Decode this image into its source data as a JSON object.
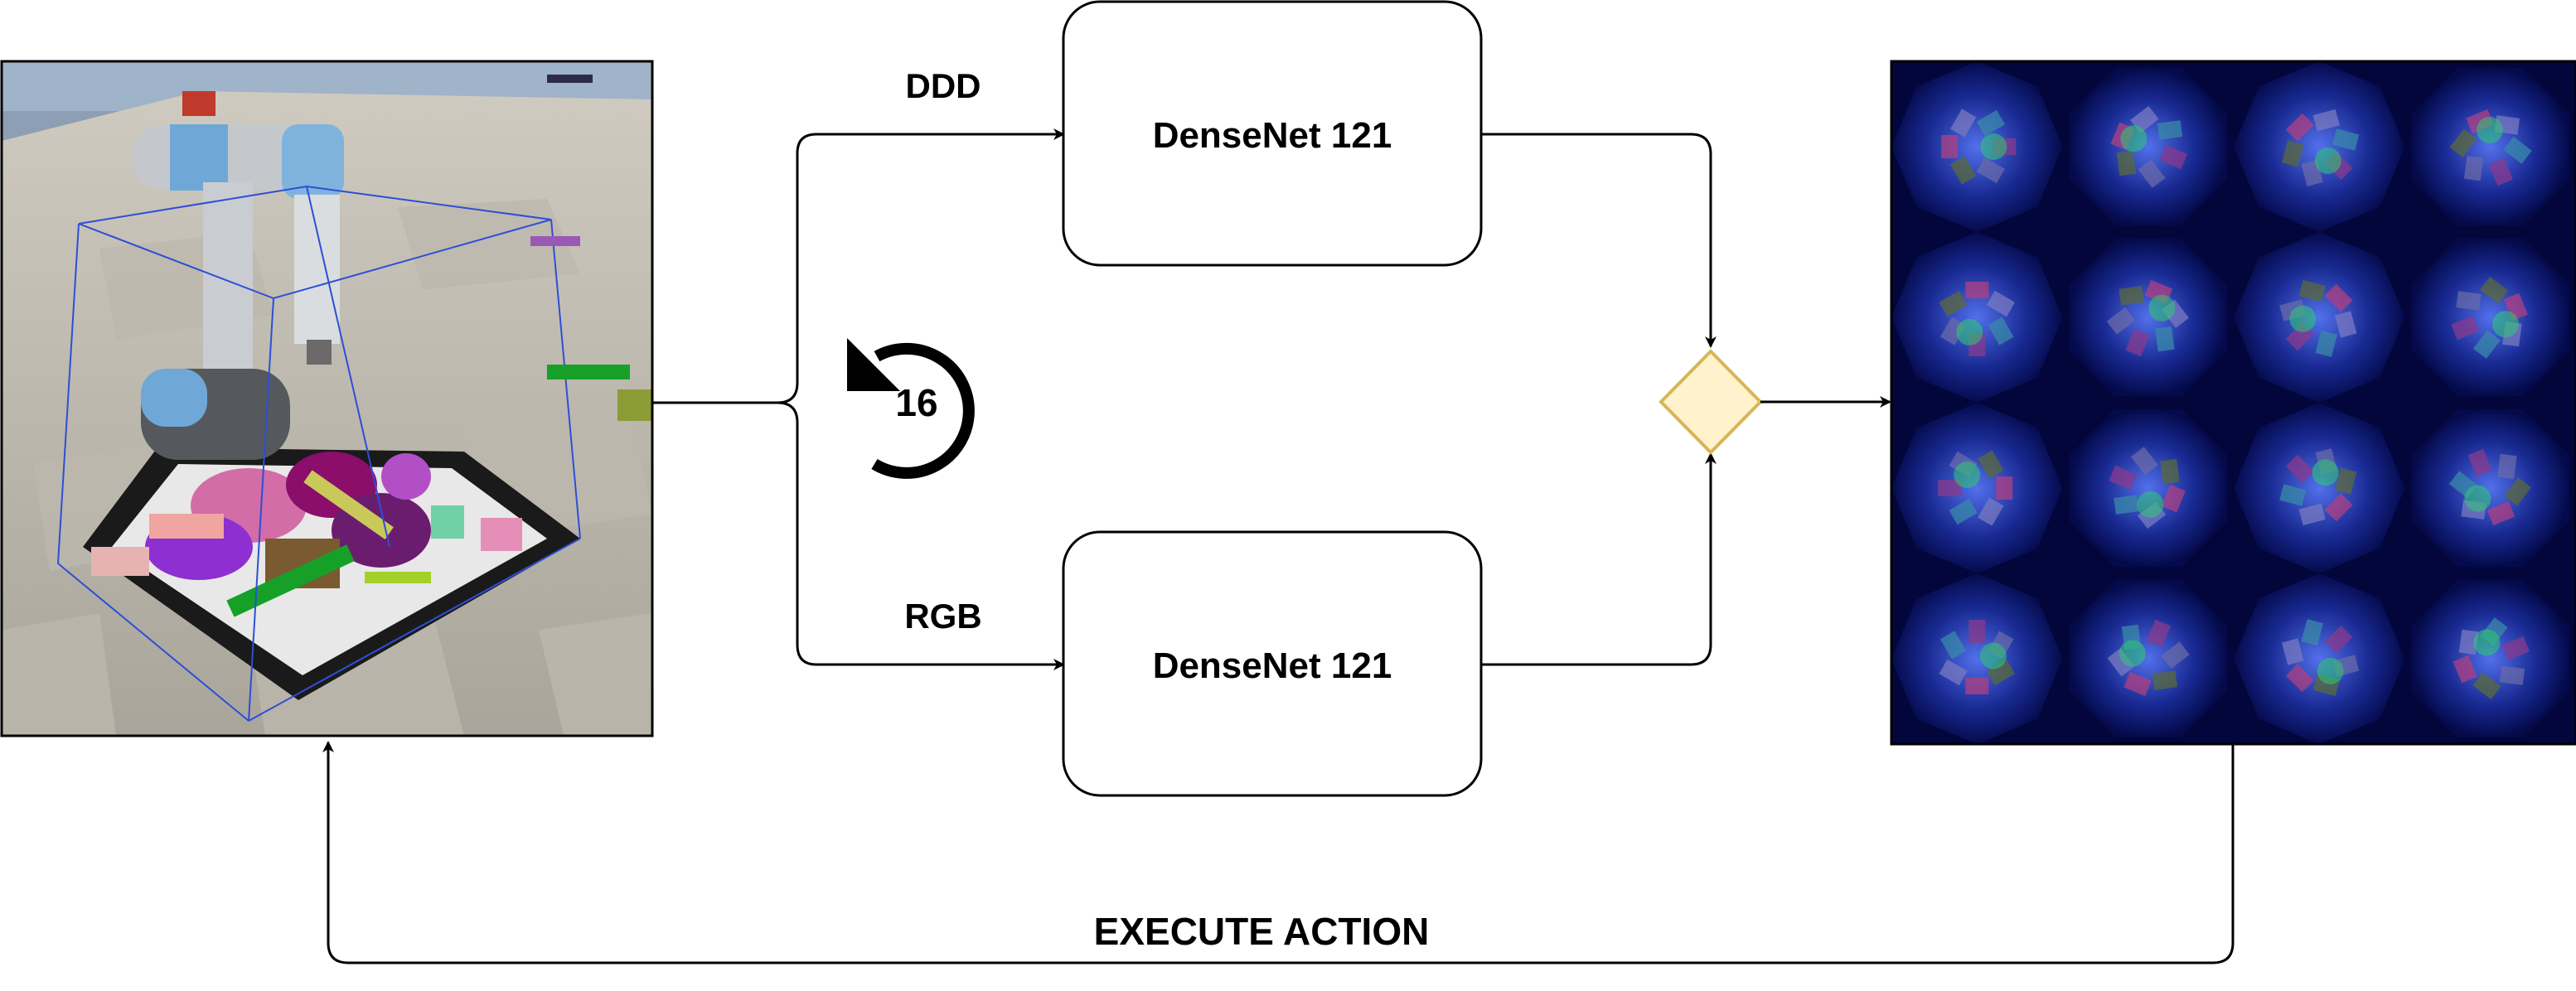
{
  "diagram": {
    "nodes": {
      "densenet_top": {
        "label": "DenseNet 121"
      },
      "densenet_bottom": {
        "label": "DenseNet 121"
      }
    },
    "edges": {
      "ddd_label": "DDD",
      "rgb_label": "RGB",
      "execute_label": "EXECUTE ACTION"
    },
    "rotation_count": "16",
    "colors": {
      "fuse_fill": "#fff2cc",
      "fuse_stroke": "#d6b656",
      "heatmap_bg": "#02063a",
      "heatmap_glow": "#2ecc71"
    }
  }
}
